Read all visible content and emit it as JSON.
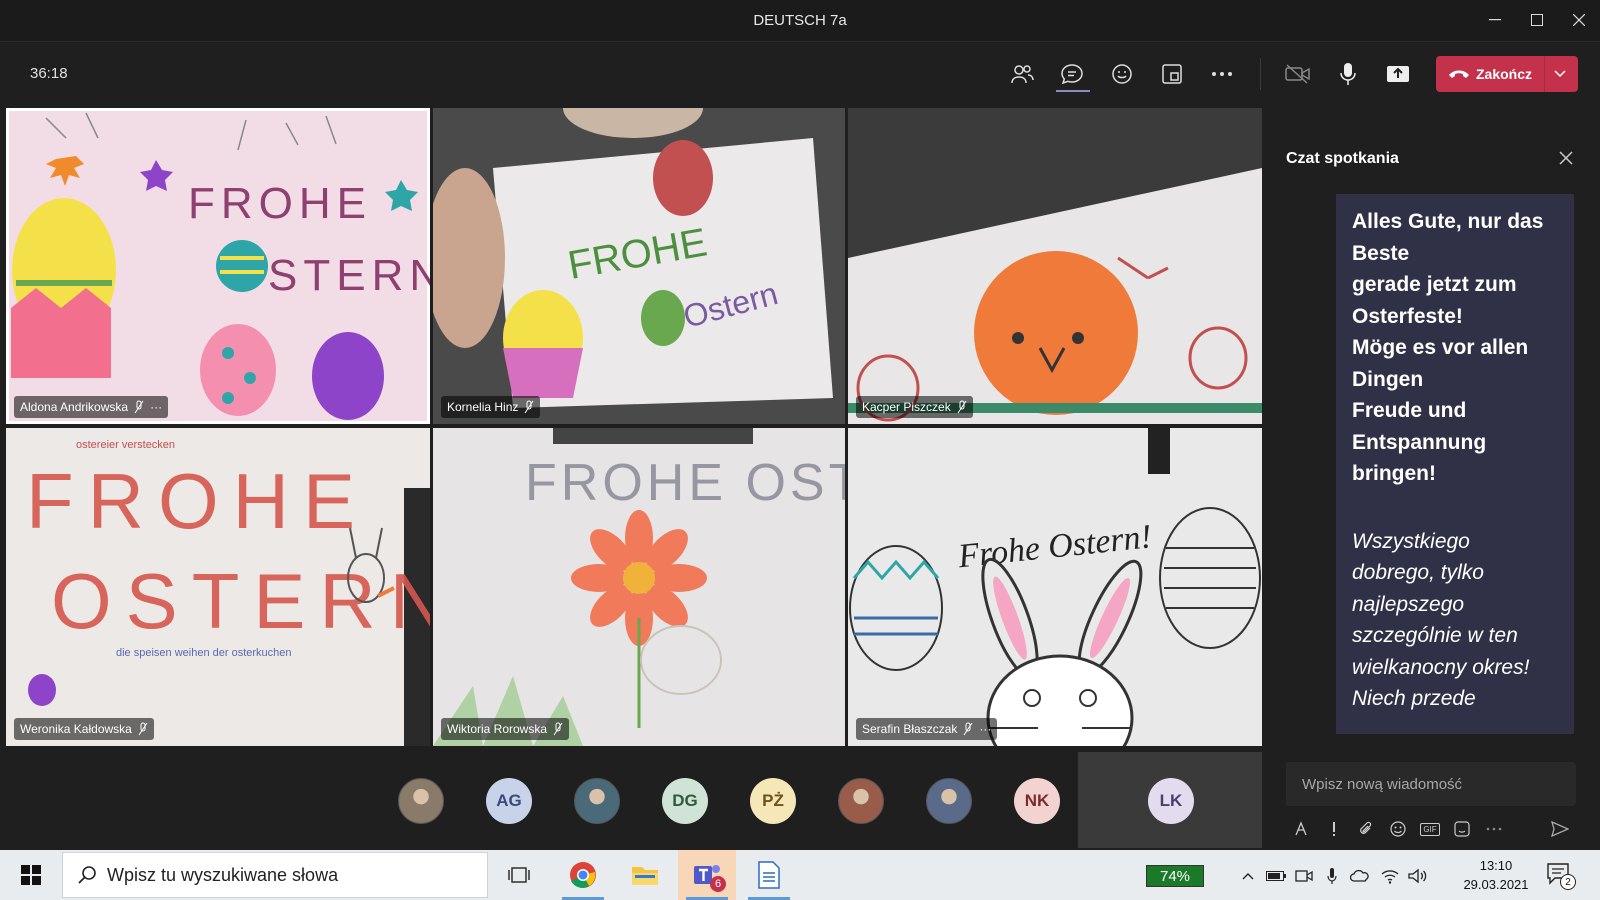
{
  "window": {
    "title": "DEUTSCH 7a"
  },
  "toolbar": {
    "timer": "36:18",
    "end_call_label": "Zakończ"
  },
  "tiles": [
    {
      "name": "Aldona Andrikowska",
      "drawing_text": "FROHE OSTERN"
    },
    {
      "name": "Kornelia Hinz",
      "drawing_text": "FROHE Ostern"
    },
    {
      "name": "Kacper Piszczek",
      "drawing_text": ""
    },
    {
      "name": "Weronika Kałdowska",
      "drawing_text": "FROHE OSTERN"
    },
    {
      "name": "Wiktoria Rorowska",
      "drawing_text": "FROHE OSTERN"
    },
    {
      "name": "Serafin Błaszczak",
      "drawing_text": "Frohe Ostern!"
    }
  ],
  "participants": [
    {
      "initials": "",
      "kind": "photo",
      "bg": "#8a7a6a"
    },
    {
      "initials": "AG",
      "kind": "initials",
      "bg": "#c8d3ea",
      "fg": "#3b4a7a"
    },
    {
      "initials": "",
      "kind": "photo",
      "bg": "#4a6a7a"
    },
    {
      "initials": "DG",
      "kind": "initials",
      "bg": "#cfe3d6",
      "fg": "#2f5a3f"
    },
    {
      "initials": "PŻ",
      "kind": "initials",
      "bg": "#f6e7b8",
      "fg": "#6a5518"
    },
    {
      "initials": "",
      "kind": "photo",
      "bg": "#9a5c4a"
    },
    {
      "initials": "",
      "kind": "photo",
      "bg": "#5a6a8a"
    },
    {
      "initials": "NK",
      "kind": "initials",
      "bg": "#f3d3d1",
      "fg": "#7a2d2a"
    },
    {
      "initials": "LK",
      "kind": "initials",
      "bg": "#e3dcef",
      "fg": "#4a3f6a"
    }
  ],
  "chat": {
    "title": "Czat spotkania",
    "message_de": "Alles Gute, nur das\nBeste\ngerade jetzt zum\nOsterfeste!\nMöge es vor allen\nDingen\nFreude und\nEntspannung\nbringen!",
    "message_pl": "Wszystkiego\ndobrego, tylko\nnajlepszego\nszczególnie w ten\nwielkanocny okres!\nNiech przede",
    "compose_placeholder": "Wpisz nową wiadomość",
    "gif_label": "GIF"
  },
  "taskbar": {
    "search_placeholder": "Wpisz tu wyszukiwane słowa",
    "teams_badge": "6",
    "battery": "74%",
    "time": "13:10",
    "date": "29.03.2021",
    "notifications": "2"
  },
  "colors": {
    "accent": "#8b8cc7",
    "end_call": "#c4314b",
    "chat_bubble": "#303147"
  }
}
